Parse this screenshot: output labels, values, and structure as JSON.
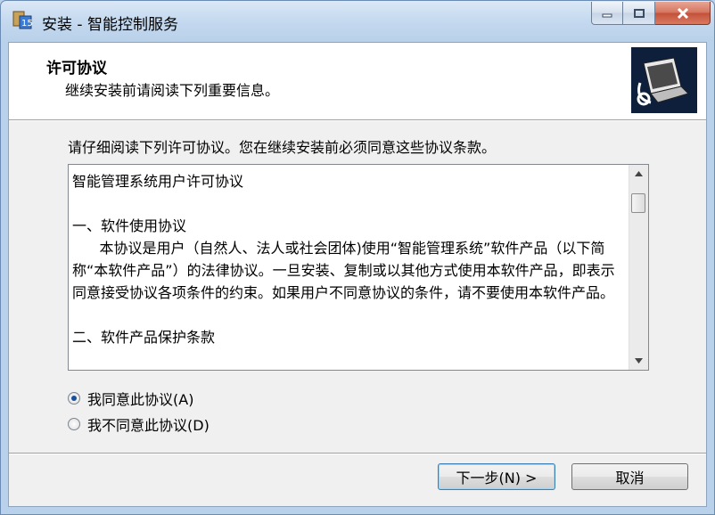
{
  "window": {
    "title": "安装 - 智能控制服务"
  },
  "header": {
    "title": "许可协议",
    "subtitle": "继续安装前请阅读下列重要信息。"
  },
  "prompt": "请仔细阅读下列许可协议。您在继续安装前必须同意这些协议条款。",
  "license": {
    "text": "智能管理系统用户许可协议\n\n一、软件使用协议\n      本协议是用户（自然人、法人或社会团体)使用“智能管理系统”软件产品（以下简称“本软件产品”）的法律协议。一旦安装、复制或以其他方式使用本软件产品，即表示同意接受协议各项条件的约束。如果用户不同意协议的条件，请不要使用本软件产品。\n\n二、软件产品保护条款"
  },
  "options": {
    "accept": "我同意此协议(A)",
    "decline": "我不同意此协议(D)",
    "selected": "accept"
  },
  "buttons": {
    "next": "下一步(N) >",
    "cancel": "取消"
  }
}
